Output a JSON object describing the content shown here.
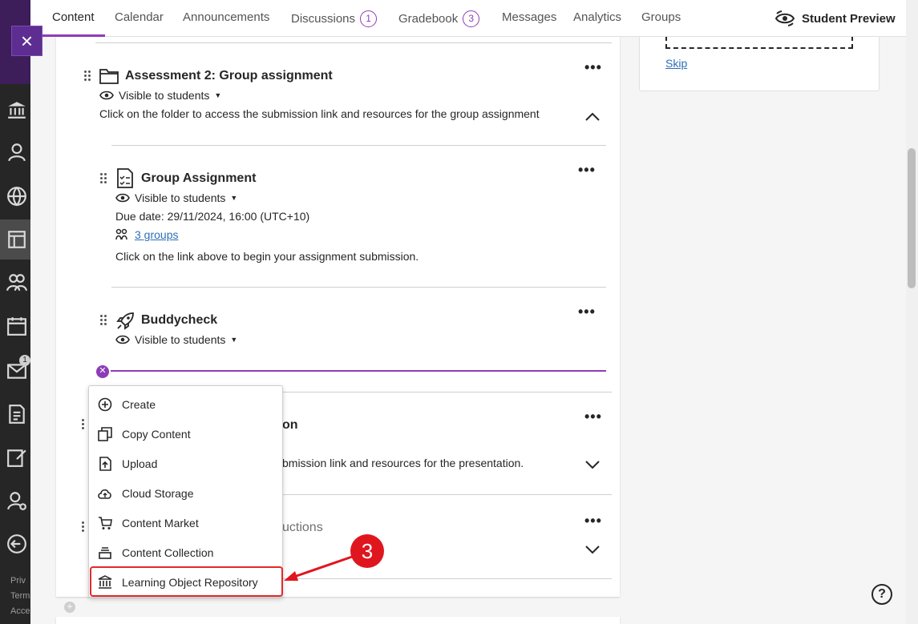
{
  "nav": {
    "close_label": "×",
    "footer": [
      "Priv",
      "Term",
      "Acce"
    ],
    "badge_count": "1"
  },
  "tabs": [
    {
      "label": "Content",
      "active": true
    },
    {
      "label": "Calendar"
    },
    {
      "label": "Announcements"
    },
    {
      "label": "Discussions",
      "count": "1"
    },
    {
      "label": "Gradebook",
      "count": "3"
    },
    {
      "label": "Messages"
    },
    {
      "label": "Analytics"
    },
    {
      "label": "Groups"
    }
  ],
  "student_preview": "Student Preview",
  "right_panel": {
    "skip": "Skip"
  },
  "items": {
    "assessment2": {
      "title": "Assessment 2: Group assignment",
      "visibility": "Visible to students",
      "description": "Click on the folder to access the submission link and resources for the group assignment"
    },
    "group_assignment": {
      "title": "Group Assignment",
      "visibility": "Visible to students",
      "due": "Due date: 29/11/2024, 16:00 (UTC+10)",
      "groups": "3 groups",
      "description": "Click on the link above to begin your assignment submission."
    },
    "buddycheck": {
      "title": "Buddycheck",
      "visibility": "Visible to students"
    },
    "presentation": {
      "title_fragment": "on",
      "description_fragment": "bmission link and resources for the presentation."
    },
    "instructions": {
      "title_fragment": "uctions"
    }
  },
  "menu": [
    {
      "label": "Create",
      "icon": "plus-circle-icon"
    },
    {
      "label": "Copy Content",
      "icon": "copy-icon"
    },
    {
      "label": "Upload",
      "icon": "upload-icon"
    },
    {
      "label": "Cloud Storage",
      "icon": "cloud-upload-icon"
    },
    {
      "label": "Content Market",
      "icon": "cart-icon"
    },
    {
      "label": "Content Collection",
      "icon": "collection-icon"
    },
    {
      "label": "Learning Object Repository",
      "icon": "institution-icon"
    }
  ],
  "callout": {
    "number": "3"
  },
  "colors": {
    "accent": "#8e3cb6",
    "annotation": "#e0161e",
    "link": "#2c6fb7"
  }
}
